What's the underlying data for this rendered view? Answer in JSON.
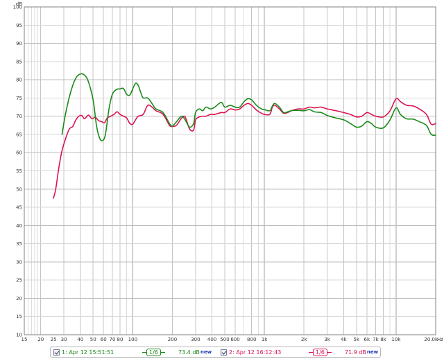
{
  "chart_data": {
    "type": "line",
    "ylabel": "dB",
    "xunit": "Hz",
    "x_scale": "log",
    "xlim": [
      15,
      20000
    ],
    "ylim": [
      10,
      100
    ],
    "grid": true,
    "y_ticks": [
      10,
      15,
      20,
      25,
      30,
      35,
      40,
      45,
      50,
      55,
      60,
      65,
      70,
      75,
      80,
      85,
      90,
      95,
      100
    ],
    "x_tick_labels": [
      {
        "x": 15,
        "label": "15"
      },
      {
        "x": 20,
        "label": "20"
      },
      {
        "x": 25,
        "label": "25"
      },
      {
        "x": 30,
        "label": "30"
      },
      {
        "x": 40,
        "label": "40"
      },
      {
        "x": 50,
        "label": "50"
      },
      {
        "x": 60,
        "label": "60"
      },
      {
        "x": 70,
        "label": "70"
      },
      {
        "x": 80,
        "label": "80"
      },
      {
        "x": 100,
        "label": "100"
      },
      {
        "x": 200,
        "label": "200"
      },
      {
        "x": 300,
        "label": "300"
      },
      {
        "x": 400,
        "label": "400"
      },
      {
        "x": 500,
        "label": "500"
      },
      {
        "x": 600,
        "label": "600"
      },
      {
        "x": 800,
        "label": "800"
      },
      {
        "x": 1000,
        "label": "1k"
      },
      {
        "x": 2000,
        "label": "2k"
      },
      {
        "x": 3000,
        "label": "3k"
      },
      {
        "x": 4000,
        "label": "4k"
      },
      {
        "x": 5000,
        "label": "5k"
      },
      {
        "x": 6000,
        "label": "6k"
      },
      {
        "x": 7000,
        "label": "7k"
      },
      {
        "x": 8000,
        "label": "8k"
      },
      {
        "x": 10000,
        "label": "10k"
      },
      {
        "x": 20000,
        "label": "20.0k"
      }
    ],
    "series": [
      {
        "name": "1: Apr 12 15:51:51",
        "color": "#1a8a1a",
        "points": [
          [
            29,
            65
          ],
          [
            31,
            71
          ],
          [
            34,
            77
          ],
          [
            37,
            80.5
          ],
          [
            40,
            81.6
          ],
          [
            43,
            81.3
          ],
          [
            46,
            79.5
          ],
          [
            50,
            74.5
          ],
          [
            53,
            67.5
          ],
          [
            56,
            64
          ],
          [
            59,
            63.3
          ],
          [
            62,
            65
          ],
          [
            66,
            72
          ],
          [
            70,
            76
          ],
          [
            75,
            77.3
          ],
          [
            80,
            77.5
          ],
          [
            85,
            77.6
          ],
          [
            90,
            76
          ],
          [
            95,
            75.8
          ],
          [
            100,
            77.5
          ],
          [
            105,
            79
          ],
          [
            110,
            78.5
          ],
          [
            115,
            76.5
          ],
          [
            120,
            75
          ],
          [
            130,
            75
          ],
          [
            140,
            73.5
          ],
          [
            150,
            72
          ],
          [
            170,
            71
          ],
          [
            190,
            68
          ],
          [
            200,
            67.3
          ],
          [
            215,
            68.5
          ],
          [
            235,
            70
          ],
          [
            250,
            69
          ],
          [
            270,
            67
          ],
          [
            290,
            68
          ],
          [
            300,
            71
          ],
          [
            320,
            72
          ],
          [
            340,
            71.5
          ],
          [
            360,
            72.5
          ],
          [
            390,
            72
          ],
          [
            420,
            72.5
          ],
          [
            470,
            73.8
          ],
          [
            500,
            72.5
          ],
          [
            550,
            73
          ],
          [
            600,
            72.5
          ],
          [
            650,
            72.5
          ],
          [
            700,
            74
          ],
          [
            750,
            74.8
          ],
          [
            800,
            74.5
          ],
          [
            870,
            73
          ],
          [
            950,
            72
          ],
          [
            1000,
            71.8
          ],
          [
            1100,
            71.5
          ],
          [
            1150,
            72.8
          ],
          [
            1200,
            73.5
          ],
          [
            1300,
            72.5
          ],
          [
            1400,
            71
          ],
          [
            1500,
            71.2
          ],
          [
            1600,
            71.5
          ],
          [
            1800,
            71.6
          ],
          [
            2000,
            71.5
          ],
          [
            2200,
            71.8
          ],
          [
            2400,
            71.2
          ],
          [
            2700,
            71
          ],
          [
            3000,
            70.2
          ],
          [
            3500,
            69.5
          ],
          [
            4000,
            69
          ],
          [
            4500,
            68
          ],
          [
            5000,
            67
          ],
          [
            5500,
            67.3
          ],
          [
            6000,
            68.5
          ],
          [
            6500,
            68
          ],
          [
            7000,
            67
          ],
          [
            8000,
            66.8
          ],
          [
            9000,
            69
          ],
          [
            10000,
            72.3
          ],
          [
            10800,
            70.5
          ],
          [
            12000,
            69.3
          ],
          [
            13500,
            69.2
          ],
          [
            15000,
            68.5
          ],
          [
            17000,
            67.5
          ],
          [
            18500,
            65
          ],
          [
            20000,
            64.8
          ]
        ]
      },
      {
        "name": "2: Apr 12 16:12:43",
        "color": "#dd1450",
        "points": [
          [
            25,
            47.5
          ],
          [
            26,
            50
          ],
          [
            27.5,
            56
          ],
          [
            29,
            60.5
          ],
          [
            31,
            64
          ],
          [
            33,
            66.5
          ],
          [
            35,
            67.2
          ],
          [
            37,
            69
          ],
          [
            39,
            70
          ],
          [
            41,
            70.2
          ],
          [
            43,
            69.3
          ],
          [
            46,
            70.3
          ],
          [
            49,
            69.3
          ],
          [
            52,
            69.7
          ],
          [
            55,
            68.8
          ],
          [
            58,
            68.5
          ],
          [
            61,
            68.2
          ],
          [
            64,
            69.5
          ],
          [
            68,
            70
          ],
          [
            72,
            70.5
          ],
          [
            76,
            71.2
          ],
          [
            80,
            70.5
          ],
          [
            85,
            70
          ],
          [
            90,
            69.5
          ],
          [
            95,
            68
          ],
          [
            100,
            67.8
          ],
          [
            105,
            69
          ],
          [
            110,
            70
          ],
          [
            120,
            70.5
          ],
          [
            130,
            73
          ],
          [
            140,
            72.5
          ],
          [
            150,
            71.5
          ],
          [
            170,
            70.5
          ],
          [
            190,
            67.5
          ],
          [
            200,
            67.2
          ],
          [
            215,
            67.5
          ],
          [
            235,
            69.5
          ],
          [
            250,
            69.8
          ],
          [
            270,
            66.5
          ],
          [
            290,
            66.2
          ],
          [
            300,
            69
          ],
          [
            320,
            69.8
          ],
          [
            340,
            70
          ],
          [
            360,
            70
          ],
          [
            390,
            70.5
          ],
          [
            420,
            70.5
          ],
          [
            470,
            71
          ],
          [
            500,
            71
          ],
          [
            550,
            72
          ],
          [
            600,
            71.7
          ],
          [
            650,
            72
          ],
          [
            700,
            73
          ],
          [
            750,
            73.5
          ],
          [
            800,
            73
          ],
          [
            870,
            71.7
          ],
          [
            950,
            70.8
          ],
          [
            1000,
            70.5
          ],
          [
            1100,
            70.5
          ],
          [
            1150,
            72.5
          ],
          [
            1200,
            73
          ],
          [
            1300,
            72
          ],
          [
            1400,
            70.8
          ],
          [
            1500,
            71
          ],
          [
            1600,
            71.5
          ],
          [
            1800,
            72
          ],
          [
            2000,
            72
          ],
          [
            2200,
            72.5
          ],
          [
            2400,
            72.3
          ],
          [
            2700,
            72.5
          ],
          [
            3000,
            72
          ],
          [
            3500,
            71.5
          ],
          [
            4000,
            71
          ],
          [
            4500,
            70.5
          ],
          [
            5000,
            69.8
          ],
          [
            5500,
            70
          ],
          [
            6000,
            71
          ],
          [
            6500,
            70.5
          ],
          [
            7000,
            70
          ],
          [
            8000,
            69.8
          ],
          [
            9000,
            71.5
          ],
          [
            10000,
            74.8
          ],
          [
            10800,
            74
          ],
          [
            12000,
            73
          ],
          [
            13500,
            72.8
          ],
          [
            15000,
            72
          ],
          [
            17000,
            70.5
          ],
          [
            18500,
            67.8
          ],
          [
            20000,
            68
          ]
        ]
      }
    ]
  },
  "legend": {
    "series1": {
      "label": "1: Apr 12 15:51:51",
      "smoothing": "1/6",
      "level": "73.4 dB",
      "new_tag": "new",
      "color": "#1a8a1a"
    },
    "series2": {
      "label": "2: Apr 12 16:12:43",
      "smoothing": "1/6",
      "level": "71.9 dB",
      "new_tag": "new",
      "color": "#dd1450"
    }
  }
}
